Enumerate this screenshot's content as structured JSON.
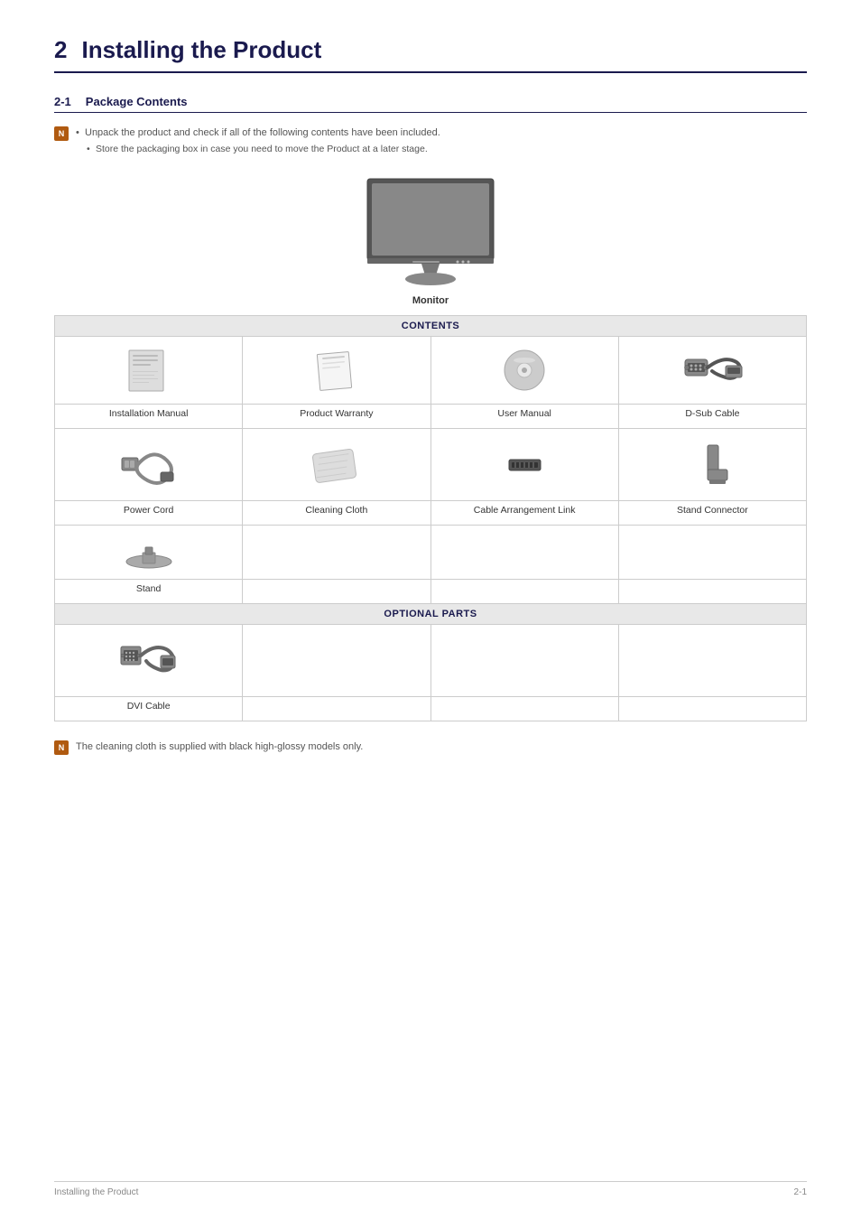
{
  "chapter": {
    "number": "2",
    "title": "Installing the Product"
  },
  "section": {
    "number": "2-1",
    "title": "Package Contents"
  },
  "notes": {
    "intro_bullet1": "Unpack the product and check if all of the following contents have been included.",
    "intro_bullet2": "Store the packaging box in case you need to move the Product at a later stage.",
    "note_icon_text": "N",
    "cleaning_note": "The cleaning cloth is supplied with black high-glossy models only."
  },
  "monitor_label": "Monitor",
  "contents_label": "CONTENTS",
  "optional_label": "OPTIONAL PARTS",
  "contents_items": [
    {
      "name": "Installation Manual",
      "row": 1
    },
    {
      "name": "Product Warranty",
      "row": 1
    },
    {
      "name": "User Manual",
      "row": 1
    },
    {
      "name": "D-Sub Cable",
      "row": 1
    },
    {
      "name": "Power Cord",
      "row": 2
    },
    {
      "name": "Cleaning Cloth",
      "row": 2
    },
    {
      "name": "Cable Arrangement Link",
      "row": 2
    },
    {
      "name": "Stand Connector",
      "row": 2
    },
    {
      "name": "Stand",
      "row": 3
    }
  ],
  "optional_items": [
    {
      "name": "DVI Cable"
    },
    {
      "name": ""
    },
    {
      "name": ""
    },
    {
      "name": ""
    }
  ],
  "footer": {
    "left": "Installing the Product",
    "right": "2-1"
  }
}
